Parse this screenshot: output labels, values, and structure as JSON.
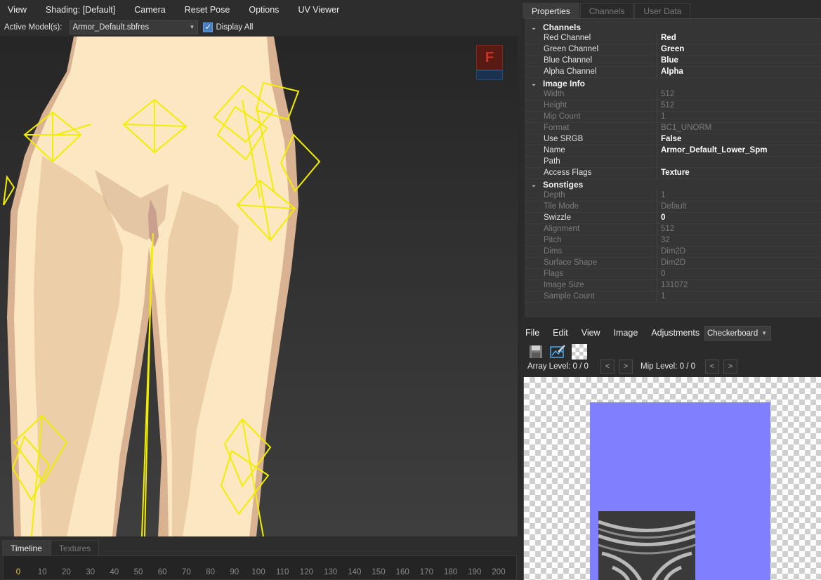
{
  "menubar": {
    "items": [
      "View",
      "Shading: [Default]",
      "Camera",
      "Reset Pose",
      "Options",
      "UV Viewer"
    ]
  },
  "modelbar": {
    "label": "Active Model(s):",
    "selected_model": "Armor_Default.sbfres",
    "display_all_label": "Display All",
    "display_all_checked": true
  },
  "viewport": {
    "gizmo_letter": "F"
  },
  "timeline": {
    "tabs": [
      "Timeline",
      "Textures"
    ],
    "active_tab": "Timeline",
    "frames": [
      "0",
      "10",
      "20",
      "30",
      "40",
      "50",
      "60",
      "70",
      "80",
      "90",
      "100",
      "110",
      "120",
      "130",
      "140",
      "150",
      "160",
      "170",
      "180",
      "190",
      "200"
    ]
  },
  "properties": {
    "tabs": [
      "Properties",
      "Channels",
      "User Data"
    ],
    "active_tab": "Properties",
    "categories": [
      {
        "name": "Channels",
        "rows": [
          {
            "name": "Red Channel",
            "value": "Red",
            "editable": true
          },
          {
            "name": "Green Channel",
            "value": "Green",
            "editable": true
          },
          {
            "name": "Blue Channel",
            "value": "Blue",
            "editable": true
          },
          {
            "name": "Alpha Channel",
            "value": "Alpha",
            "editable": true
          }
        ]
      },
      {
        "name": "Image Info",
        "rows": [
          {
            "name": "Width",
            "value": "512",
            "editable": false
          },
          {
            "name": "Height",
            "value": "512",
            "editable": false
          },
          {
            "name": "Mip Count",
            "value": "1",
            "editable": false
          },
          {
            "name": "Format",
            "value": "BC1_UNORM",
            "editable": false
          },
          {
            "name": "Use SRGB",
            "value": "False",
            "editable": true
          },
          {
            "name": "Name",
            "value": "Armor_Default_Lower_Spm",
            "editable": true
          },
          {
            "name": "Path",
            "value": "",
            "editable": true
          },
          {
            "name": "Access Flags",
            "value": "Texture",
            "editable": true
          }
        ]
      },
      {
        "name": "Sonstiges",
        "rows": [
          {
            "name": "Depth",
            "value": "1",
            "editable": false
          },
          {
            "name": "Tile Mode",
            "value": "Default",
            "editable": false
          },
          {
            "name": "Swizzle",
            "value": "0",
            "editable": true
          },
          {
            "name": "Alignment",
            "value": "512",
            "editable": false
          },
          {
            "name": "Pitch",
            "value": "32",
            "editable": false
          },
          {
            "name": "Dims",
            "value": "Dim2D",
            "editable": false
          },
          {
            "name": "Surface Shape",
            "value": "Dim2D",
            "editable": false
          },
          {
            "name": "Flags",
            "value": "0",
            "editable": false
          },
          {
            "name": "Image Size",
            "value": "131072",
            "editable": false
          },
          {
            "name": "Sample Count",
            "value": "1",
            "editable": false
          }
        ]
      }
    ]
  },
  "uv_viewer": {
    "menu": [
      "File",
      "Edit",
      "View",
      "Image",
      "Adjustments"
    ],
    "background_select": "Checkerboard",
    "array_level_label": "Array Level: 0 / 0",
    "mip_level_label": "Mip Level: 0 / 0",
    "prev_symbol": "<",
    "next_symbol": ">",
    "texture_color": "#8080ff"
  },
  "colors": {
    "bone": "#f2ee00",
    "skin": "#fbe7c2",
    "skin_shadow": "#d9b292"
  }
}
